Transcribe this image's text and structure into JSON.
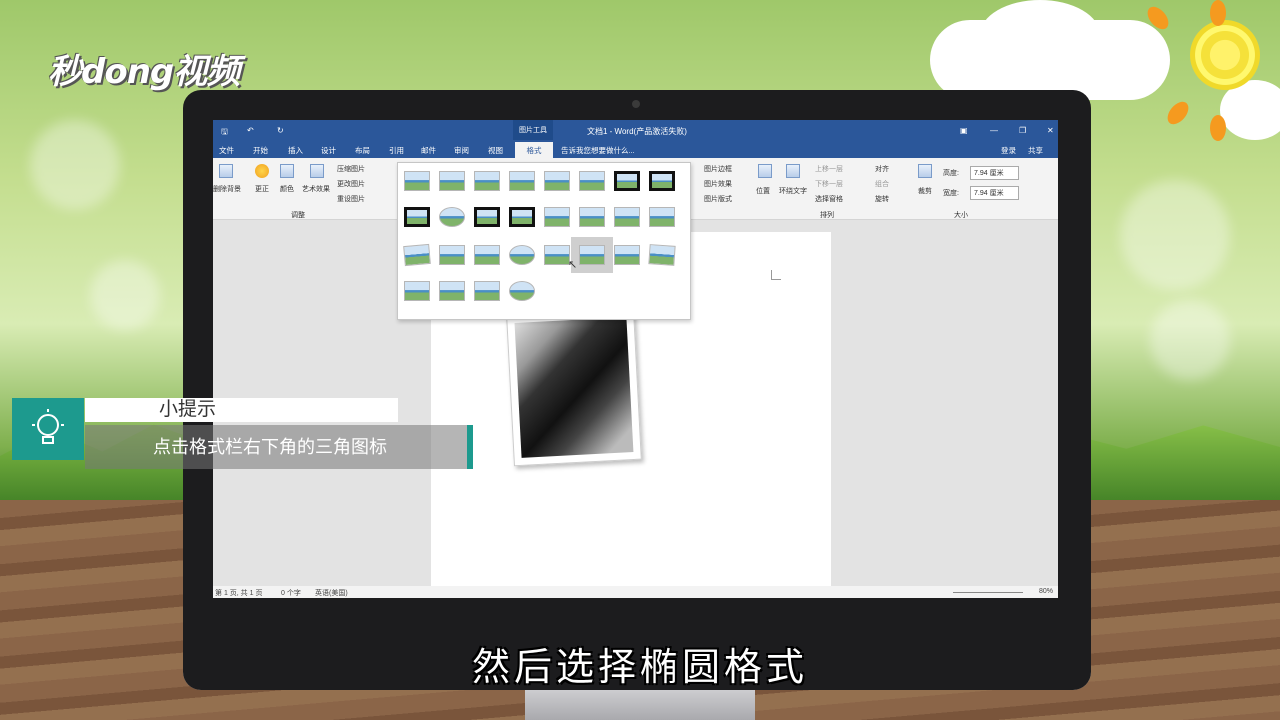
{
  "brand": {
    "logo_text": "秒dong视频"
  },
  "word": {
    "title": "文档1 - Word(产品激活失败)",
    "context_tab_group": "图片工具",
    "tabs": [
      "文件",
      "开始",
      "插入",
      "设计",
      "布局",
      "引用",
      "邮件",
      "审阅",
      "视图"
    ],
    "active_tab": "格式",
    "tell_me_placeholder": "告诉我您想要做什么...",
    "login": "登录",
    "share": "共享",
    "ribbon": {
      "remove_bg": "删除背景",
      "corrections": "更正",
      "color": "颜色",
      "artistic": "艺术效果",
      "compress": "压缩图片",
      "change": "更改图片",
      "reset": "重设图片",
      "group_adjust": "调整",
      "border": "图片边框",
      "effects": "图片效果",
      "layout": "图片版式",
      "position": "位置",
      "wrap_text": "环绕文字",
      "bring_forward": "上移一层",
      "send_backward": "下移一层",
      "selection_pane": "选择窗格",
      "align": "对齐",
      "group": "组合",
      "rotate": "旋转",
      "group_arrange": "排列",
      "crop": "裁剪",
      "height_label": "高度:",
      "height_value": "7.94 厘米",
      "width_label": "宽度:",
      "width_value": "7.94 厘米",
      "group_size": "大小"
    },
    "status": {
      "page": "第 1 页, 共 1 页",
      "words": "0 个字",
      "lang": "英语(美国)",
      "zoom": "80%"
    }
  },
  "tip": {
    "heading": "小提示",
    "text": "点击格式栏右下角的三角图标"
  },
  "subtitle": "然后选择椭圆格式"
}
